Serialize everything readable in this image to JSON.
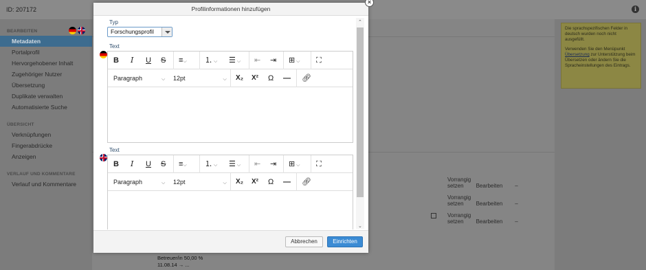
{
  "topbar": {
    "id_label": "ID: 207172",
    "info_icon": "i"
  },
  "sidebar": {
    "section_edit": "BEARBEITEN",
    "edit_items": [
      {
        "label": "Metadaten"
      },
      {
        "label": "Portalprofil"
      },
      {
        "label": "Hervorgehobener Inhalt"
      },
      {
        "label": "Zugehöriger Nutzer"
      },
      {
        "label": "Übersetzung"
      },
      {
        "label": "Duplikate verwalten"
      },
      {
        "label": "Automatisierte Suche"
      }
    ],
    "section_overview": "ÜBERSICHT",
    "overview_items": [
      {
        "label": "Verknüpfungen"
      },
      {
        "label": "Fingerabdrücke"
      },
      {
        "label": "Anzeigen"
      }
    ],
    "section_history": "VERLAUF UND KOMMENTARE",
    "history_items": [
      {
        "label": "Verlauf und Kommentare"
      }
    ]
  },
  "main": {
    "row_actions": {
      "prioritize": "Vorrangig setzen",
      "edit": "Bearbeiten",
      "dash": "–"
    },
    "below_lines": [
      "Betreuer/in 50,00 %",
      "11.08.14 → ..."
    ]
  },
  "note": {
    "text1": "Die sprachspezifischen Felder in deutsch wurden noch nicht ausgefüllt.",
    "text2_before": "Verwenden Sie den Menüpunkt",
    "text2_link": "Übersetzung",
    "text2_after": "zur Unterstützung beim Übersetzen oder ändern Sie die Spracheinstellungen des Eintrags."
  },
  "modal": {
    "title": "Profilinformationen hinzufügen",
    "type_label": "Typ",
    "type_value": "Forschungsprofil",
    "text_label": "Text",
    "editor": {
      "paragraph": "Paragraph",
      "font_size": "12pt",
      "bold": "B",
      "italic": "I",
      "underline": "U",
      "strike": "S",
      "omega": "Ω"
    },
    "cancel_label": "Abbrechen",
    "ok_label": "Einrichten"
  },
  "colors": {
    "accent": "#3b8bd4",
    "sidebar_active": "#3d6c8f",
    "note_bg": "#8c8744"
  }
}
